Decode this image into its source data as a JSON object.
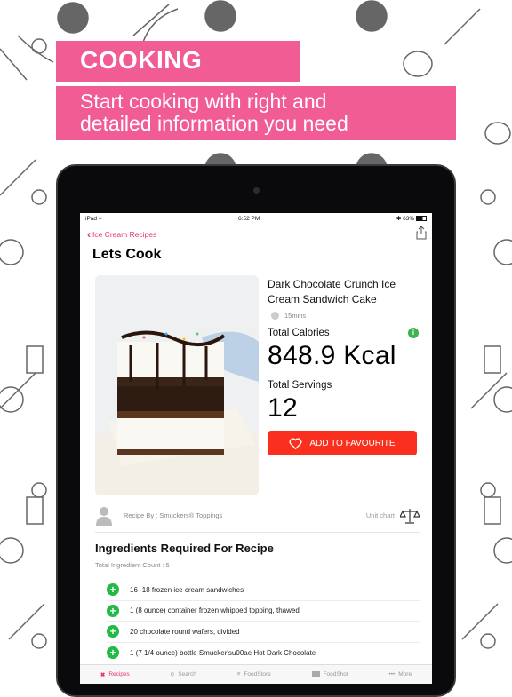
{
  "banner": {
    "title": "COOKING",
    "subtitle_line1": "Start cooking with right and",
    "subtitle_line2": "detailed information you need"
  },
  "statusbar": {
    "device": "iPad",
    "time": "6:52 PM",
    "battery": "63%"
  },
  "nav": {
    "back_label": "Ice Cream Recipes",
    "title": "Lets Cook"
  },
  "recipe": {
    "name": "Dark Chocolate Crunch Ice Cream Sandwich Cake",
    "time": "15mins",
    "calories_label": "Total Calories",
    "calories_value": "848.9 Kcal",
    "servings_label": "Total Servings",
    "servings_value": "12",
    "favourite_button": "ADD TO FAVOURITE",
    "recipe_by": "Recipe By : Smuckers® Toppings",
    "unit_chart": "Unit chart"
  },
  "ingredients": {
    "title": "Ingredients Required For Recipe",
    "count_label": "Total Ingredient Count   :   5",
    "items": [
      "16 -18 frozen ice cream sandwiches",
      "1 (8 ounce) container frozen whipped topping, thawed",
      "20 chocolate round wafers, divided",
      "1 (7 1/4 ounce) bottle Smucker'su00ae Hot Dark Chocolate"
    ]
  },
  "tabbar": {
    "tabs": [
      {
        "label": "Recipes",
        "icon": "fork-knife-icon",
        "active": true
      },
      {
        "label": "Search",
        "icon": "search-icon",
        "active": false
      },
      {
        "label": "FoodStore",
        "icon": "store-icon",
        "active": false
      },
      {
        "label": "FoodShot",
        "icon": "camera-icon",
        "active": false
      },
      {
        "label": "More",
        "icon": "more-icon",
        "active": false
      }
    ]
  },
  "colors": {
    "banner_pink": "#f25c94",
    "accent_pink": "#e8336e",
    "favourite_red": "#fb2f1d",
    "plus_green": "#21ba45"
  }
}
